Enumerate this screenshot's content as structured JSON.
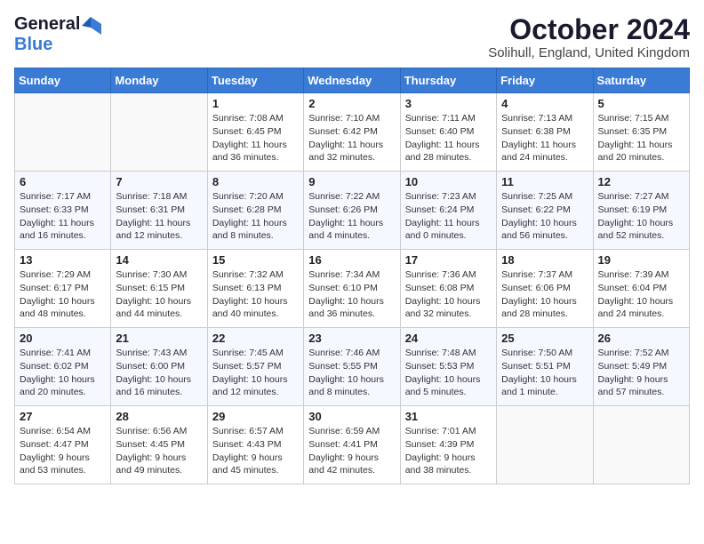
{
  "header": {
    "logo_general": "General",
    "logo_blue": "Blue",
    "month_title": "October 2024",
    "subtitle": "Solihull, England, United Kingdom"
  },
  "days_of_week": [
    "Sunday",
    "Monday",
    "Tuesday",
    "Wednesday",
    "Thursday",
    "Friday",
    "Saturday"
  ],
  "weeks": [
    [
      {
        "day": "",
        "text": ""
      },
      {
        "day": "",
        "text": ""
      },
      {
        "day": "1",
        "text": "Sunrise: 7:08 AM\nSunset: 6:45 PM\nDaylight: 11 hours and 36 minutes."
      },
      {
        "day": "2",
        "text": "Sunrise: 7:10 AM\nSunset: 6:42 PM\nDaylight: 11 hours and 32 minutes."
      },
      {
        "day": "3",
        "text": "Sunrise: 7:11 AM\nSunset: 6:40 PM\nDaylight: 11 hours and 28 minutes."
      },
      {
        "day": "4",
        "text": "Sunrise: 7:13 AM\nSunset: 6:38 PM\nDaylight: 11 hours and 24 minutes."
      },
      {
        "day": "5",
        "text": "Sunrise: 7:15 AM\nSunset: 6:35 PM\nDaylight: 11 hours and 20 minutes."
      }
    ],
    [
      {
        "day": "6",
        "text": "Sunrise: 7:17 AM\nSunset: 6:33 PM\nDaylight: 11 hours and 16 minutes."
      },
      {
        "day": "7",
        "text": "Sunrise: 7:18 AM\nSunset: 6:31 PM\nDaylight: 11 hours and 12 minutes."
      },
      {
        "day": "8",
        "text": "Sunrise: 7:20 AM\nSunset: 6:28 PM\nDaylight: 11 hours and 8 minutes."
      },
      {
        "day": "9",
        "text": "Sunrise: 7:22 AM\nSunset: 6:26 PM\nDaylight: 11 hours and 4 minutes."
      },
      {
        "day": "10",
        "text": "Sunrise: 7:23 AM\nSunset: 6:24 PM\nDaylight: 11 hours and 0 minutes."
      },
      {
        "day": "11",
        "text": "Sunrise: 7:25 AM\nSunset: 6:22 PM\nDaylight: 10 hours and 56 minutes."
      },
      {
        "day": "12",
        "text": "Sunrise: 7:27 AM\nSunset: 6:19 PM\nDaylight: 10 hours and 52 minutes."
      }
    ],
    [
      {
        "day": "13",
        "text": "Sunrise: 7:29 AM\nSunset: 6:17 PM\nDaylight: 10 hours and 48 minutes."
      },
      {
        "day": "14",
        "text": "Sunrise: 7:30 AM\nSunset: 6:15 PM\nDaylight: 10 hours and 44 minutes."
      },
      {
        "day": "15",
        "text": "Sunrise: 7:32 AM\nSunset: 6:13 PM\nDaylight: 10 hours and 40 minutes."
      },
      {
        "day": "16",
        "text": "Sunrise: 7:34 AM\nSunset: 6:10 PM\nDaylight: 10 hours and 36 minutes."
      },
      {
        "day": "17",
        "text": "Sunrise: 7:36 AM\nSunset: 6:08 PM\nDaylight: 10 hours and 32 minutes."
      },
      {
        "day": "18",
        "text": "Sunrise: 7:37 AM\nSunset: 6:06 PM\nDaylight: 10 hours and 28 minutes."
      },
      {
        "day": "19",
        "text": "Sunrise: 7:39 AM\nSunset: 6:04 PM\nDaylight: 10 hours and 24 minutes."
      }
    ],
    [
      {
        "day": "20",
        "text": "Sunrise: 7:41 AM\nSunset: 6:02 PM\nDaylight: 10 hours and 20 minutes."
      },
      {
        "day": "21",
        "text": "Sunrise: 7:43 AM\nSunset: 6:00 PM\nDaylight: 10 hours and 16 minutes."
      },
      {
        "day": "22",
        "text": "Sunrise: 7:45 AM\nSunset: 5:57 PM\nDaylight: 10 hours and 12 minutes."
      },
      {
        "day": "23",
        "text": "Sunrise: 7:46 AM\nSunset: 5:55 PM\nDaylight: 10 hours and 8 minutes."
      },
      {
        "day": "24",
        "text": "Sunrise: 7:48 AM\nSunset: 5:53 PM\nDaylight: 10 hours and 5 minutes."
      },
      {
        "day": "25",
        "text": "Sunrise: 7:50 AM\nSunset: 5:51 PM\nDaylight: 10 hours and 1 minute."
      },
      {
        "day": "26",
        "text": "Sunrise: 7:52 AM\nSunset: 5:49 PM\nDaylight: 9 hours and 57 minutes."
      }
    ],
    [
      {
        "day": "27",
        "text": "Sunrise: 6:54 AM\nSunset: 4:47 PM\nDaylight: 9 hours and 53 minutes."
      },
      {
        "day": "28",
        "text": "Sunrise: 6:56 AM\nSunset: 4:45 PM\nDaylight: 9 hours and 49 minutes."
      },
      {
        "day": "29",
        "text": "Sunrise: 6:57 AM\nSunset: 4:43 PM\nDaylight: 9 hours and 45 minutes."
      },
      {
        "day": "30",
        "text": "Sunrise: 6:59 AM\nSunset: 4:41 PM\nDaylight: 9 hours and 42 minutes."
      },
      {
        "day": "31",
        "text": "Sunrise: 7:01 AM\nSunset: 4:39 PM\nDaylight: 9 hours and 38 minutes."
      },
      {
        "day": "",
        "text": ""
      },
      {
        "day": "",
        "text": ""
      }
    ]
  ]
}
